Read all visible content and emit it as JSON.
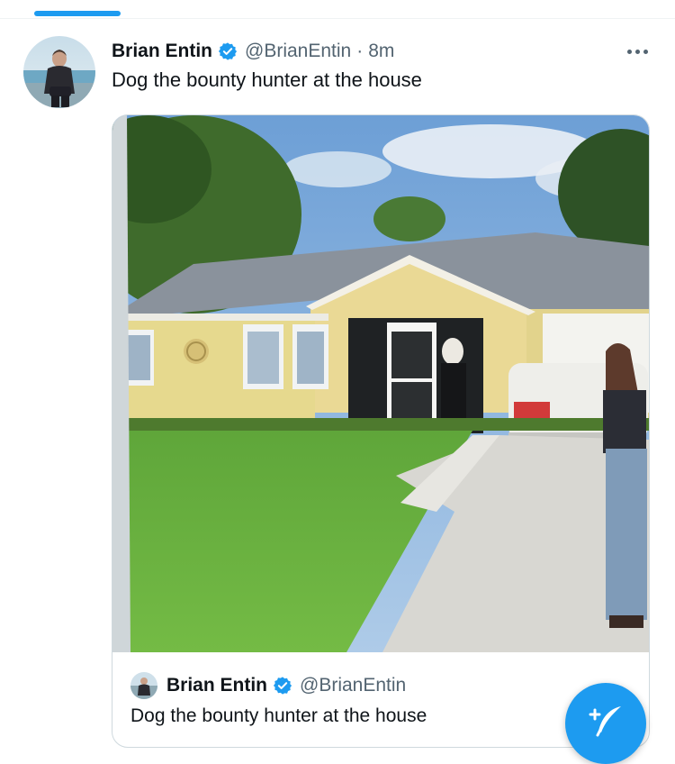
{
  "colors": {
    "accent": "#1d9bf0",
    "text_primary": "#0f1419",
    "text_secondary": "#536471"
  },
  "tweet": {
    "author_name": "Brian Entin",
    "handle": "@BrianEntin",
    "separator": "·",
    "time": "8m",
    "text": "Dog the bounty hunter at the house",
    "verified_icon": "verified-badge-icon",
    "more_icon": "more-options-icon"
  },
  "quoted_tweet": {
    "author_name": "Brian Entin",
    "handle": "@BrianEntin",
    "text": "Dog the bounty hunter at the house",
    "verified_icon": "verified-badge-icon"
  },
  "compose_button": {
    "icon": "compose-tweet-icon"
  }
}
